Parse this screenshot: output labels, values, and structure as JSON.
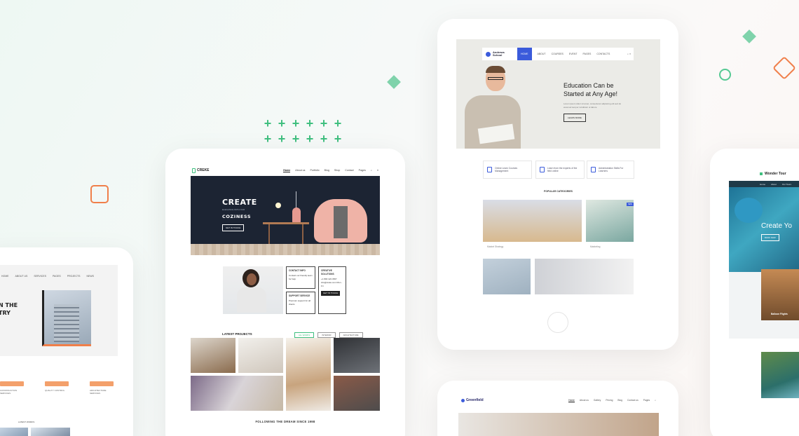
{
  "colors": {
    "accent_green": "#3fbf7f",
    "accent_orange": "#f07f4a",
    "accent_blue": "#3b5bdb"
  },
  "left_site": {
    "nav": [
      "HOME",
      "ABOUT US",
      "SERVICES",
      "PAGES",
      "PROJECTS",
      "NEWS"
    ],
    "hero_title_1": "N THE",
    "hero_title_2": "TRY",
    "features": [
      "CONSTRUCTION SERVICES",
      "QUALITY CONTROL",
      "ARCHITECTURE SERVICES"
    ],
    "section_label": "LATEST WORKS"
  },
  "center_site": {
    "logo": "CREKE",
    "nav": [
      "Home",
      "About us",
      "Portfolio",
      "Blog",
      "Shop",
      "Contact",
      "Pages"
    ],
    "hero_line1": "CREATE",
    "hero_sub": "ELEGANCE WITH OUR",
    "hero_line2": "COZINESS",
    "hero_button": "GET IN TOUCH",
    "card1_title": "CONTACT INFO",
    "card1_text": "Contact our friendly team for help",
    "card2_title": "SUPPORT SERVICE",
    "card2_text": "Premium support for all clients",
    "card3_title": "CREATIVE SOLUTIONS",
    "card3_text": "+1 800 123 4567 info@creke.com Mon - Fri",
    "card3_button": "GET IN TOUCH",
    "latest_projects": "LATEST PROJECTS",
    "filters": [
      "ALL WORKS",
      "INTERIOR",
      "ARCHITECTURE"
    ],
    "footer_heading": "FOLLOWING THE DREAM SINCE 1998"
  },
  "school_site": {
    "logo_line1": "Andrews",
    "logo_line2": "School",
    "nav": [
      "HOME",
      "ABOUT",
      "COURSES",
      "EVENT",
      "PAGES",
      "CONTACTS"
    ],
    "hero_title_1": "Education Can be",
    "hero_title_2": "Started at Any Age!",
    "hero_text": "Lorem ipsum dolor sit amet, consectetur adipiscing elit sed do eiusmod tempor incididunt ut labore",
    "hero_button": "LEARN MORE",
    "features": [
      "Online Learn Courses Management",
      "Learn from the experts of the field online",
      "Administration Skills For Learners"
    ],
    "popular_heading": "POPULAR CATEGORIES",
    "card1_caption": "Market Strategy",
    "card2_caption": "Marketing",
    "badge_new": "NEW"
  },
  "tour_site": {
    "logo": "Wonder Tour",
    "nav": [
      "Home",
      "About",
      "Our Tours"
    ],
    "hero_title": "Create Yo",
    "hero_button": "BOOK NOW",
    "card_title": "Balloon Flights"
  },
  "corp_site": {
    "logo": "Greenfield",
    "nav": [
      "Home",
      "About us",
      "Gallery",
      "Pricing",
      "Blog",
      "Contact us",
      "Pages"
    ]
  }
}
